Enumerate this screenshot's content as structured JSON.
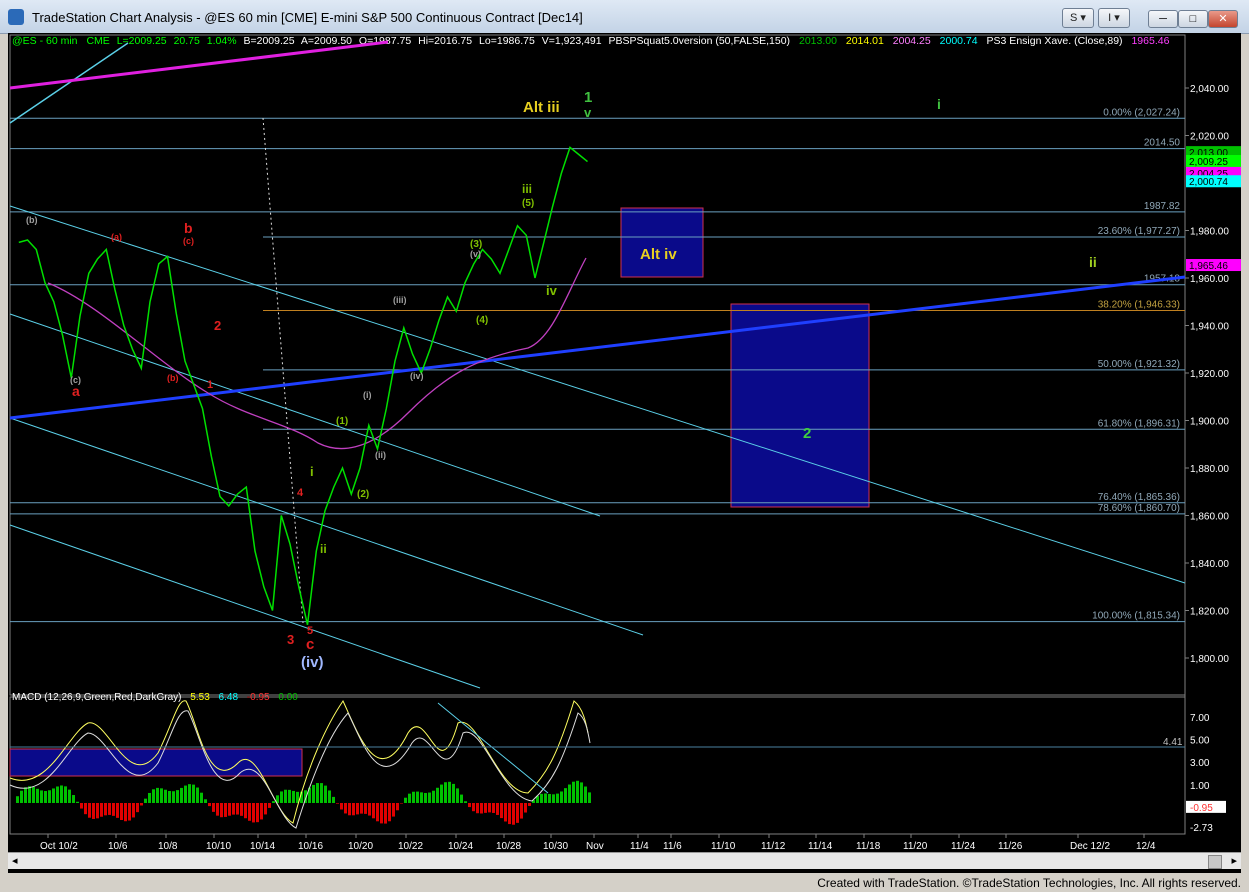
{
  "window": {
    "title": "TradeStation Chart Analysis - @ES 60 min [CME] E-mini S&P 500 Continuous Contract [Dec14]",
    "s_button": "S",
    "i_button": "I"
  },
  "header": {
    "symbol": "@ES - 60 min",
    "exchange": "CME",
    "last": "L=2009.25",
    "change": "20.75",
    "pct": "1.04%",
    "bid": "B=2009.25",
    "ask": "A=2009.50",
    "open": "O=1987.75",
    "high": "Hi=2016.75",
    "low": "Lo=1986.75",
    "volume": "V=1,923,491",
    "study1": "PBSPSquat5.0version (50,FALSE,150)",
    "s1": "2013.00",
    "s2": "2014.01",
    "s3": "2004.25",
    "s4": "2000.74",
    "study2": "PS3 Ensign Xave. (Close,89)",
    "s5": "1965.46"
  },
  "macd_header": {
    "label": "MACD (12,26,9,Green,Red,DarkGray)",
    "v1": "5.53",
    "v2": "6.48",
    "v3": "-0.95",
    "v4": "0.00"
  },
  "chart_data": {
    "type": "line",
    "title": "@ES 60 min E-mini S&P 500 Continuous Contract [Dec14]",
    "ylim": [
      1790,
      2050
    ],
    "x_ticks": [
      "Oct",
      "10/2",
      "10/6",
      "10/8",
      "10/10",
      "10/14",
      "10/16",
      "10/20",
      "10/22",
      "10/24",
      "10/28",
      "10/30",
      "Nov",
      "11/4",
      "11/6",
      "11/10",
      "11/12",
      "11/14",
      "11/18",
      "11/20",
      "11/24",
      "11/26",
      "Dec",
      "12/2",
      "12/4"
    ],
    "y_ticks": [
      "2,040.00",
      "2,020.00",
      "1,980.00",
      "1,960.00",
      "1,940.00",
      "1,920.00",
      "1,900.00",
      "1,880.00",
      "1,860.00",
      "1,840.00",
      "1,820.00",
      "1,800.00"
    ],
    "y_tick_values": [
      2040,
      2020,
      1980,
      1960,
      1940,
      1920,
      1900,
      1880,
      1860,
      1840,
      1820,
      1800
    ],
    "price_tags": [
      {
        "label": "2,013.00",
        "value": 2013.0,
        "color": "#00c000"
      },
      {
        "label": "2,009.25",
        "value": 2009.25,
        "color": "#00ff00"
      },
      {
        "label": "2,004.25",
        "value": 2004.25,
        "color": "#ff00ff"
      },
      {
        "label": "2,000.74",
        "value": 2000.74,
        "color": "#00ffff"
      },
      {
        "label": "1,965.46",
        "value": 1965.46,
        "color": "#ff00ff"
      }
    ],
    "horizontal_levels": [
      {
        "label": "0.00% (2,027.24)",
        "value": 2027.24
      },
      {
        "label": "2014.50",
        "value": 2014.5
      },
      {
        "label": "1987.82",
        "value": 1987.82
      },
      {
        "label": "23.60% (1,977.27)",
        "value": 1977.27
      },
      {
        "label": "1957.18",
        "value": 1957.18
      },
      {
        "label": "38.20% (1,946.33)",
        "value": 1946.33
      },
      {
        "label": "50.00% (1,921.32)",
        "value": 1921.32
      },
      {
        "label": "61.80% (1,896.31)",
        "value": 1896.31
      },
      {
        "label": "76.40% (1,865.36)",
        "value": 1865.36
      },
      {
        "label": "78.60% (1,860.70)",
        "value": 1860.7
      },
      {
        "label": "100.00% (1,815.34)",
        "value": 1815.34
      }
    ],
    "price_series": [
      [
        1,
        1975
      ],
      [
        2,
        1976
      ],
      [
        3,
        1972
      ],
      [
        4,
        1958
      ],
      [
        5,
        1950
      ],
      [
        6,
        1936
      ],
      [
        7,
        1918
      ],
      [
        8,
        1944
      ],
      [
        9,
        1962
      ],
      [
        10,
        1968
      ],
      [
        11,
        1972
      ],
      [
        12,
        1955
      ],
      [
        13,
        1940
      ],
      [
        14,
        1930
      ],
      [
        15,
        1922
      ],
      [
        16,
        1950
      ],
      [
        17,
        1966
      ],
      [
        18,
        1969
      ],
      [
        19,
        1945
      ],
      [
        20,
        1925
      ],
      [
        21,
        1915
      ],
      [
        22,
        1905
      ],
      [
        23,
        1885
      ],
      [
        24,
        1868
      ],
      [
        25,
        1864
      ],
      [
        26,
        1869
      ],
      [
        27,
        1872
      ],
      [
        28,
        1845
      ],
      [
        29,
        1830
      ],
      [
        30,
        1820
      ],
      [
        31,
        1860
      ],
      [
        32,
        1848
      ],
      [
        33,
        1830
      ],
      [
        34,
        1814
      ],
      [
        35,
        1845
      ],
      [
        36,
        1862
      ],
      [
        37,
        1872
      ],
      [
        38,
        1880
      ],
      [
        39,
        1869
      ],
      [
        40,
        1880
      ],
      [
        41,
        1898
      ],
      [
        42,
        1888
      ],
      [
        43,
        1905
      ],
      [
        44,
        1925
      ],
      [
        45,
        1939
      ],
      [
        46,
        1928
      ],
      [
        47,
        1920
      ],
      [
        48,
        1930
      ],
      [
        49,
        1942
      ],
      [
        50,
        1952
      ],
      [
        51,
        1946
      ],
      [
        52,
        1958
      ],
      [
        53,
        1966
      ],
      [
        54,
        1972
      ],
      [
        55,
        1968
      ],
      [
        56,
        1962
      ],
      [
        57,
        1972
      ],
      [
        58,
        1982
      ],
      [
        59,
        1978
      ],
      [
        60,
        1960
      ],
      [
        61,
        1975
      ],
      [
        62,
        1990
      ],
      [
        63,
        2004
      ],
      [
        64,
        2015
      ],
      [
        65,
        2012
      ],
      [
        66,
        2009
      ]
    ],
    "x_range": [
      0,
      180
    ],
    "macd_ylim": [
      -3.2,
      8
    ],
    "macd_ticks": [
      "7.00",
      "5.00",
      "3.00",
      "1.00",
      "-0.95",
      "-2.73"
    ],
    "macd_tick_values": [
      7,
      5,
      3,
      1,
      -0.95,
      -2.73
    ],
    "macd_marker": "4.41",
    "wave_labels": {
      "alt_iii": "Alt iii",
      "one": "1",
      "v": "v",
      "i_top": "i",
      "ii_right": "ii",
      "alt_iv": "Alt iv",
      "two": "2",
      "iii_green": "iii",
      "w5": "(5)",
      "iv_green": "iv",
      "w3": "(3)",
      "wv": "(v)",
      "w4": "(4)",
      "wiii": "(iii)",
      "wiv": "(iv)",
      "wi": "(i)",
      "wii": "(ii)",
      "w1": "(1)",
      "w2": "(2)",
      "i_low": "i",
      "ii_low": "ii",
      "b_label": "(b)",
      "a_label": "(a)",
      "b_red": "b",
      "c_red_small": "(c)",
      "two_red": "2",
      "c_label": "(c)",
      "a_red": "a",
      "b_red_small": "(b)",
      "one_red": "1",
      "four_red": "4",
      "three_red": "3",
      "five_red": "5",
      "c_red": "c",
      "wave_iv": "(iv)"
    },
    "colors": {
      "price": "#00e000",
      "fib": "#4a7fa0",
      "channel": "#5bd0e8",
      "trend_blue": "#1f3fff",
      "ma": "#c040c0",
      "box": "#0a0a8a",
      "box_border": "#d03050",
      "macd_pos": "#00c000",
      "macd_neg": "#e00000"
    }
  },
  "footer": {
    "text": "Created with TradeStation. ©TradeStation Technologies, Inc. All rights reserved."
  }
}
